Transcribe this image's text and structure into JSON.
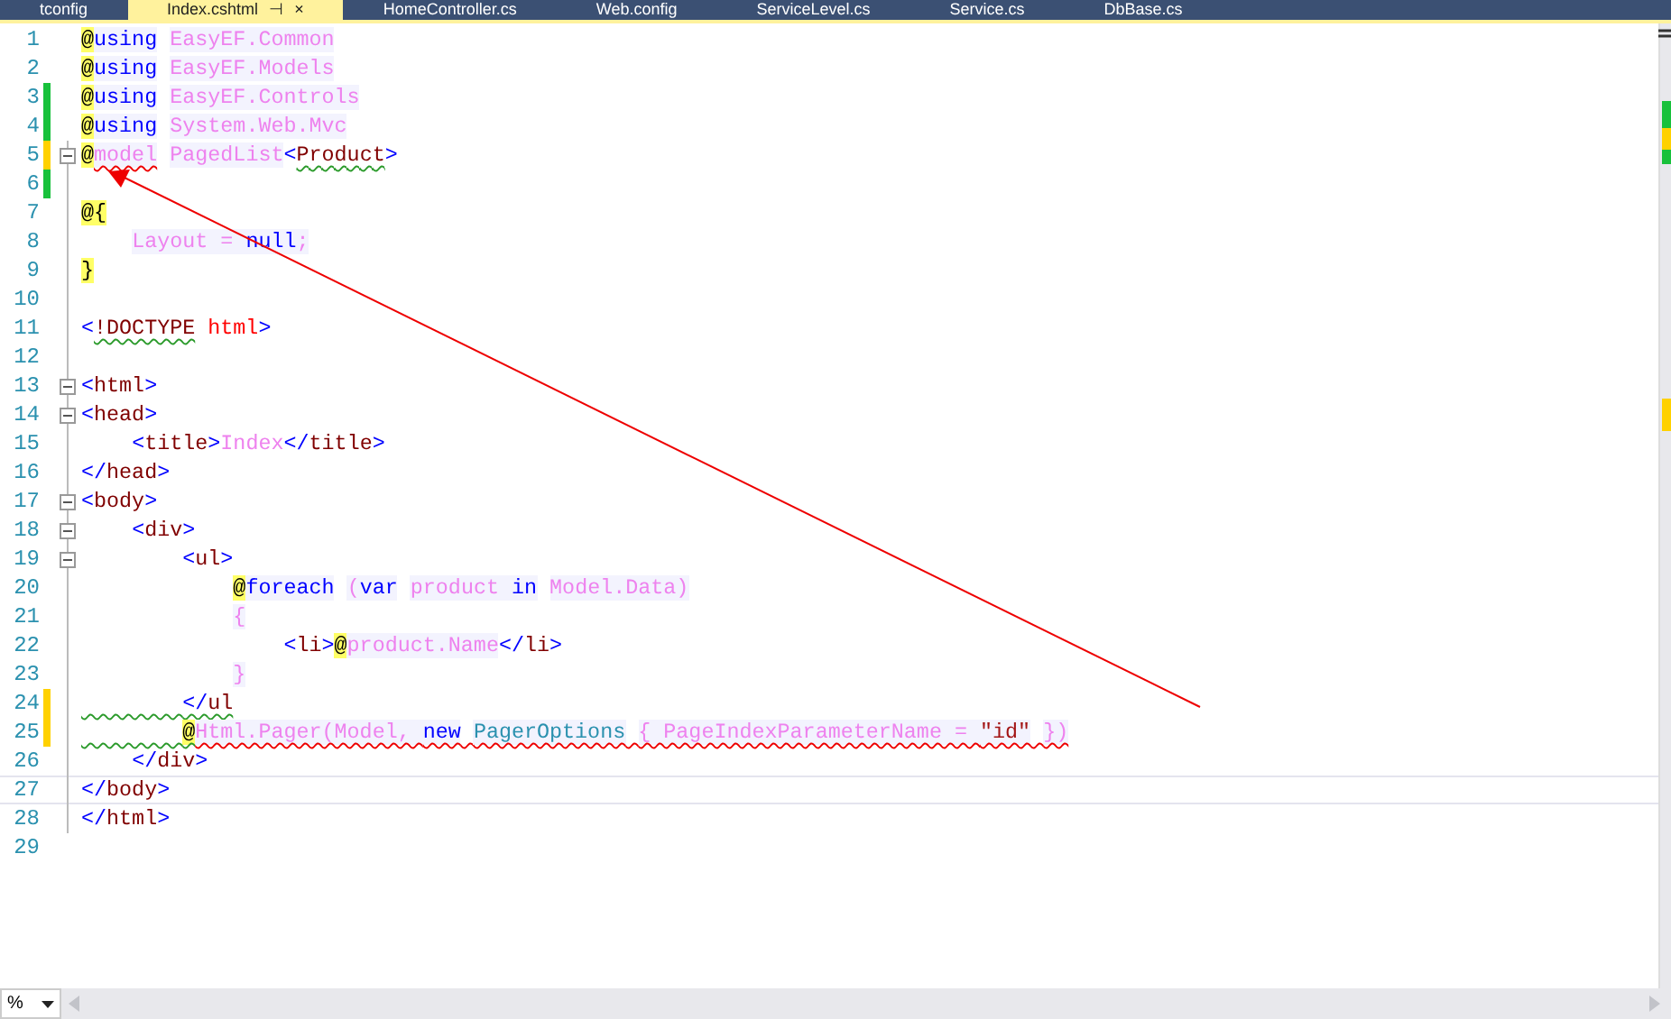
{
  "tabs": [
    {
      "label": "tconfig",
      "selected": false
    },
    {
      "label": "Index.cshtml",
      "selected": true,
      "pin": "⊣",
      "close": "×"
    },
    {
      "label": "HomeController.cs",
      "selected": false
    },
    {
      "label": "Web.config",
      "selected": false
    },
    {
      "label": "ServiceLevel.cs",
      "selected": false
    },
    {
      "label": "Service.cs",
      "selected": false
    },
    {
      "label": "DbBase.cs",
      "selected": false
    }
  ],
  "editor": {
    "lines": [
      {
        "number": "1",
        "tokens": [
          {
            "text": "@",
            "kind": "at"
          },
          {
            "text": "using",
            "kind": "kw"
          },
          {
            "text": " EasyEF.Common",
            "kind": "razor"
          }
        ]
      },
      {
        "number": "2",
        "tokens": [
          {
            "text": "@",
            "kind": "at"
          },
          {
            "text": "using",
            "kind": "kw"
          },
          {
            "text": " EasyEF.Models",
            "kind": "razor"
          }
        ]
      },
      {
        "number": "3",
        "color": "#18c13b",
        "tokens": [
          {
            "text": "@",
            "kind": "at"
          },
          {
            "text": "using",
            "kind": "kw"
          },
          {
            "text": " EasyEF.Controls",
            "kind": "razor"
          }
        ]
      },
      {
        "number": "4",
        "color": "#18c13b",
        "tokens": [
          {
            "text": "@",
            "kind": "at"
          },
          {
            "text": "using",
            "kind": "kw"
          },
          {
            "text": " System.Web.Mvc",
            "kind": "razor"
          }
        ]
      },
      {
        "number": "5",
        "color": "#ffd100",
        "fold": true,
        "tokens": [
          {
            "text": "@",
            "kind": "at"
          },
          {
            "text": "model",
            "kind": "razor",
            "error": true
          },
          {
            "text": " PagedList",
            "kind": "razor"
          },
          {
            "text": "<",
            "kind": "bracket"
          },
          {
            "text": "Product",
            "kind": "tag",
            "warning": true
          },
          {
            "text": ">",
            "kind": "bracket"
          }
        ]
      },
      {
        "number": "6",
        "color": "#18c13b"
      },
      {
        "number": "7",
        "tokens": [
          {
            "text": "@{",
            "kind": "at"
          }
        ]
      },
      {
        "number": "8",
        "tokens": [
          {
            "text": "    Layout = ",
            "kind": "razor"
          },
          {
            "text": "null",
            "kind": "kw"
          },
          {
            "text": ";",
            "kind": "razor"
          }
        ]
      },
      {
        "number": "9",
        "tokens": [
          {
            "text": "}",
            "kind": "at"
          }
        ]
      },
      {
        "number": "10"
      },
      {
        "number": "11",
        "tokens": [
          {
            "text": "<",
            "kind": "bracket"
          },
          {
            "text": "!DOCTYPE",
            "kind": "tag",
            "warning": true
          },
          {
            "text": " html",
            "kind": "attr"
          },
          {
            "text": ">",
            "kind": "bracket"
          }
        ]
      },
      {
        "number": "12"
      },
      {
        "number": "13",
        "fold": true,
        "tokens": [
          {
            "text": "<",
            "kind": "bracket"
          },
          {
            "text": "html",
            "kind": "tag"
          },
          {
            "text": ">",
            "kind": "bracket"
          }
        ]
      },
      {
        "number": "14",
        "fold": true,
        "tokens": [
          {
            "text": "<",
            "kind": "bracket"
          },
          {
            "text": "head",
            "kind": "tag"
          },
          {
            "text": ">",
            "kind": "bracket"
          }
        ]
      },
      {
        "number": "15",
        "tokens": [
          {
            "text": "    <",
            "kind": "bracket"
          },
          {
            "text": "title",
            "kind": "tag"
          },
          {
            "text": ">",
            "kind": "bracket"
          },
          {
            "text": "Index",
            "kind": "content"
          },
          {
            "text": "</",
            "kind": "bracket"
          },
          {
            "text": "title",
            "kind": "tag"
          },
          {
            "text": ">",
            "kind": "bracket"
          }
        ]
      },
      {
        "number": "16",
        "tokens": [
          {
            "text": "</",
            "kind": "bracket"
          },
          {
            "text": "head",
            "kind": "tag"
          },
          {
            "text": ">",
            "kind": "bracket"
          }
        ]
      },
      {
        "number": "17",
        "fold": true,
        "tokens": [
          {
            "text": "<",
            "kind": "bracket"
          },
          {
            "text": "body",
            "kind": "tag"
          },
          {
            "text": ">",
            "kind": "bracket"
          }
        ]
      },
      {
        "number": "18",
        "fold": true,
        "tokens": [
          {
            "text": "    <",
            "kind": "bracket"
          },
          {
            "text": "div",
            "kind": "tag"
          },
          {
            "text": ">",
            "kind": "bracket"
          }
        ]
      },
      {
        "number": "19",
        "fold": true,
        "tokens": [
          {
            "text": "        <",
            "kind": "bracket"
          },
          {
            "text": "ul",
            "kind": "tag"
          },
          {
            "text": ">",
            "kind": "bracket"
          }
        ]
      },
      {
        "number": "20",
        "tokens": [
          {
            "text": "            @",
            "kind": "at"
          },
          {
            "text": "foreach",
            "kind": "kw"
          },
          {
            "text": " (",
            "kind": "razor"
          },
          {
            "text": "var",
            "kind": "kw"
          },
          {
            "text": " product ",
            "kind": "razor"
          },
          {
            "text": "in",
            "kind": "kw"
          },
          {
            "text": " Model.Data)",
            "kind": "razor"
          }
        ]
      },
      {
        "number": "21",
        "tokens": [
          {
            "text": "            {",
            "kind": "razor"
          }
        ]
      },
      {
        "number": "22",
        "tokens": [
          {
            "text": "                <",
            "kind": "bracket"
          },
          {
            "text": "li",
            "kind": "tag"
          },
          {
            "text": ">",
            "kind": "bracket"
          },
          {
            "text": "@",
            "kind": "at"
          },
          {
            "text": "product.Name",
            "kind": "razor"
          },
          {
            "text": "</",
            "kind": "bracket"
          },
          {
            "text": "li",
            "kind": "tag"
          },
          {
            "text": ">",
            "kind": "bracket"
          }
        ]
      },
      {
        "number": "23",
        "tokens": [
          {
            "text": "            }",
            "kind": "razor"
          }
        ]
      },
      {
        "number": "24",
        "color": "#ffd100",
        "tokens": [
          {
            "text": "        </",
            "kind": "bracket",
            "warning": true
          },
          {
            "text": "ul",
            "kind": "tag",
            "warning": true
          }
        ]
      },
      {
        "number": "25",
        "color": "#ffd100",
        "tokens": [
          {
            "text": "        @",
            "kind": "at",
            "warning": true
          },
          {
            "text": "Html.Pager(Model, ",
            "kind": "razor",
            "error": true
          },
          {
            "text": "new",
            "kind": "kw",
            "error": true
          },
          {
            "text": " PagerOptions",
            "kind": "type",
            "error": true
          },
          {
            "text": " { PageIndexParameterName = ",
            "kind": "razor",
            "error": true
          },
          {
            "text": "\"id\"",
            "kind": "str",
            "error": true
          },
          {
            "text": " })",
            "kind": "razor",
            "error": true
          }
        ]
      },
      {
        "number": "26",
        "tokens": [
          {
            "text": "    </",
            "kind": "bracket"
          },
          {
            "text": "div",
            "kind": "tag"
          },
          {
            "text": ">",
            "kind": "bracket"
          }
        ]
      },
      {
        "number": "27",
        "current": true,
        "tokens": [
          {
            "text": "</",
            "kind": "bracket"
          },
          {
            "text": "body",
            "kind": "tag"
          },
          {
            "text": ">",
            "kind": "bracket"
          }
        ]
      },
      {
        "number": "28",
        "tokens": [
          {
            "text": "</",
            "kind": "bracket"
          },
          {
            "text": "html",
            "kind": "tag"
          },
          {
            "text": ">",
            "kind": "bracket"
          }
        ]
      },
      {
        "number": "29"
      }
    ]
  },
  "zoom": {
    "value": "%"
  }
}
